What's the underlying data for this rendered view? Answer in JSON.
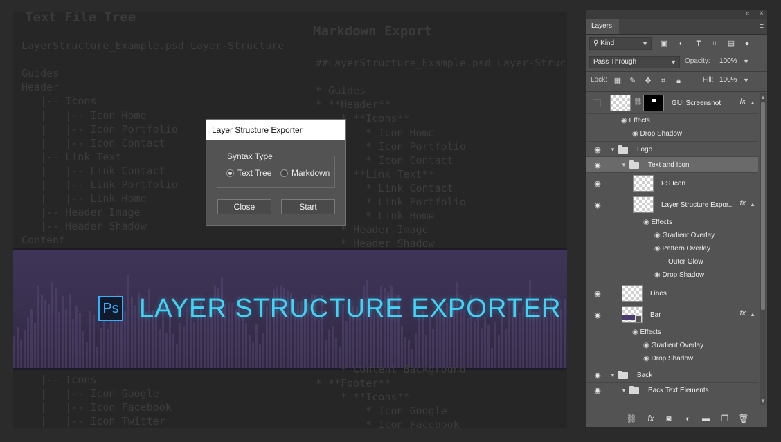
{
  "canvas": {
    "tree_title": "Text File Tree",
    "md_title": "Markdown Export",
    "tree_lines": [
      "LayerStructure_Example.psd Layer-Structure",
      "",
      "Guides",
      "Header",
      "   |-- Icons",
      "   |   |-- Icon Home",
      "   |   |-- Icon Portfolio",
      "   |   |-- Icon Contact",
      "   |-- Link Text",
      "   |   |-- Link Contact",
      "   |   |-- Link Portfolio",
      "   |   |-- Link Home",
      "   |-- Header Image",
      "   |-- Header Shadow",
      "Content"
    ],
    "tree_lines_bottom": [
      "   |-- Icons",
      "   |   |-- Icon Google",
      "   |   |-- Icon Facebook",
      "   |   |-- Icon Twitter"
    ],
    "md_lines": [
      "##LayerStructure_Example.psd Layer-Struc",
      "",
      "* Guides",
      "* **Header**",
      "    * **Icons**",
      "        * Icon Home",
      "        * Icon Portfolio",
      "        * Icon Contact",
      "    * **Link Text**",
      "        * Link Contact",
      "        * Link Portfolio",
      "        * Link Home",
      "    * Header Image",
      "    * Header Shadow"
    ],
    "md_lines_bottom": [
      "    * Content Background",
      "* **Footer**",
      "    * **Icons**",
      "        * Icon Google",
      "        * Icon Facebook"
    ],
    "banner": {
      "logo_text": "Ps",
      "title": "LAYER STRUCTURE EXPORTER",
      "title_color": "#3fd4f5",
      "bg_color": "#3a3050"
    }
  },
  "dialog": {
    "title": "Layer Structure Exporter",
    "group_label": "Syntax Type",
    "options": [
      {
        "label": "Text Tree",
        "selected": true
      },
      {
        "label": "Markdown",
        "selected": false
      }
    ],
    "close_label": "Close",
    "start_label": "Start"
  },
  "panel": {
    "collapse_glyph": "«",
    "close_glyph": "×",
    "tab_label": "Layers",
    "filter_kind": "Kind",
    "blend_mode": "Pass Through",
    "opacity_label": "Opacity:",
    "opacity_value": "100%",
    "lock_label": "Lock:",
    "fill_label": "Fill:",
    "fill_value": "100%",
    "effects_label": "Effects",
    "layers": {
      "gui_screenshot": "GUI Screenshot",
      "gui_effect_1": "Drop Shadow",
      "logo": "Logo",
      "text_and_icon": "Text and Icon",
      "ps_icon": "PS Icon",
      "layer_structure": "Layer Structure Expor...",
      "ls_effect_1": "Gradient Overlay",
      "ls_effect_2": "Pattern Overlay",
      "ls_effect_3": "Outer Glow",
      "ls_effect_4": "Drop Shadow",
      "lines": "Lines",
      "bar": "Bar",
      "bar_effect_1": "Gradient Overlay",
      "bar_effect_2": "Drop Shadow",
      "back": "Back",
      "back_text": "Back Text Elements"
    }
  }
}
